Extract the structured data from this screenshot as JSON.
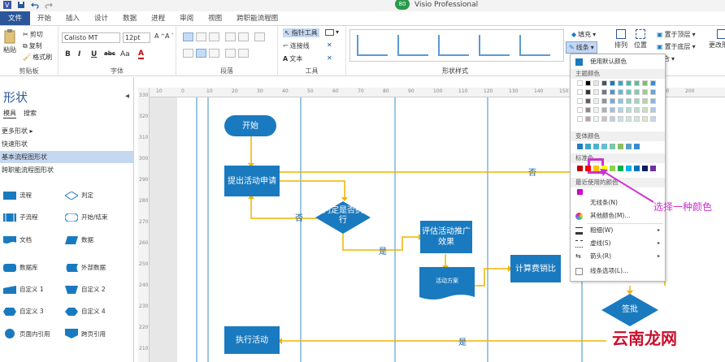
{
  "app": {
    "title": "Visio Professional",
    "badge": "80"
  },
  "tabs": [
    "文件",
    "开始",
    "插入",
    "设计",
    "数据",
    "进程",
    "审阅",
    "视图",
    "跨职能流程图"
  ],
  "ribbon": {
    "clipboard": {
      "label": "剪贴板",
      "paste": "粘贴",
      "cut": "剪切",
      "copy": "复制",
      "format_painter": "格式刷"
    },
    "font": {
      "label": "字体",
      "font_name": "Calisto MT",
      "font_size": "12pt",
      "bold": "B",
      "italic": "I",
      "underline": "U",
      "strike": "abc",
      "case": "Aa",
      "color": "A"
    },
    "paragraph": {
      "label": "段落"
    },
    "tools": {
      "label": "工具",
      "pointer": "指针工具",
      "connector": "连接线",
      "text": "文本"
    },
    "shape_styles": {
      "label": "形状样式"
    },
    "format": {
      "fill": "填充",
      "line": "线条",
      "arrange": "排列",
      "position": "位置",
      "bring_front": "置于顶层",
      "send_back": "置于底层",
      "group": "组合",
      "change_shape": "更改形状"
    }
  },
  "shapes_pane": {
    "title": "形状",
    "tabs": [
      "模具",
      "搜索"
    ],
    "stencils": [
      "更多形状",
      "快速形状",
      "基本流程图形状",
      "跨职能流程图形状"
    ],
    "selected_stencil": "基本流程图形状",
    "items": [
      {
        "label": "流程",
        "icon": "process-rect-icon"
      },
      {
        "label": "判定",
        "icon": "decision-diamond-icon"
      },
      {
        "label": "子流程",
        "icon": "subprocess-icon"
      },
      {
        "label": "开始/结束",
        "icon": "terminator-icon"
      },
      {
        "label": "文档",
        "icon": "document-icon"
      },
      {
        "label": "数据",
        "icon": "data-parallelogram-icon"
      },
      {
        "label": "数据库",
        "icon": "database-icon"
      },
      {
        "label": "外部数据",
        "icon": "external-data-icon"
      },
      {
        "label": "自定义 1",
        "icon": "custom1-icon"
      },
      {
        "label": "自定义 2",
        "icon": "custom2-icon"
      },
      {
        "label": "自定义 3",
        "icon": "custom3-icon"
      },
      {
        "label": "自定义 4",
        "icon": "custom4-icon"
      },
      {
        "label": "页面内引用",
        "icon": "on-page-ref-icon"
      },
      {
        "label": "跨页引用",
        "icon": "off-page-ref-icon"
      }
    ]
  },
  "ruler": {
    "h_ticks": [
      "10",
      "0",
      "10",
      "20",
      "30",
      "40",
      "50",
      "60",
      "70",
      "80",
      "90",
      "100",
      "110",
      "120",
      "130",
      "140",
      "150",
      "160",
      "170",
      "180",
      "190",
      "200"
    ],
    "v_ticks": [
      "330",
      "320",
      "310",
      "300",
      "290",
      "280",
      "270",
      "260",
      "250",
      "240",
      "230",
      "220",
      "210"
    ]
  },
  "diagram": {
    "start": "开始",
    "submit": "提出活动申请",
    "decision": "判定是否执行",
    "evaluate": "评估活动推广效果",
    "plan_doc": "活动方案",
    "calc": "计算费销比",
    "sign": "签批",
    "execute": "执行活动",
    "yes": "是",
    "no": "否"
  },
  "dropdown": {
    "use_default": "使用默认颜色",
    "theme_colors": "主题颜色",
    "variant_colors": "变体颜色",
    "standard_colors": "标准色",
    "recent_colors": "最近使用的颜色",
    "no_line": "无线条(N)",
    "more_colors": "其他颜色(M)...",
    "weight": "粗细(W)",
    "dashes": "虚线(S)",
    "arrows": "箭头(R)",
    "line_options": "线条选项(L)...",
    "standard_swatches": [
      "#c00000",
      "#ff0000",
      "#ffc000",
      "#ffff00",
      "#92d050",
      "#00b050",
      "#00b0f0",
      "#0070c0",
      "#002060",
      "#7030a0"
    ],
    "variant_swatches": [
      "#1f7fbf",
      "#39a7c7",
      "#4db3c9",
      "#66c0cf",
      "#7fc6ad",
      "#8fbf5e",
      "#5aa0c8",
      "#3b8bd1"
    ],
    "recent_swatches": [
      "#cc00cc"
    ]
  },
  "annotation": "选择一种颜色",
  "watermark": {
    "text": "云南龙网",
    "url": "www.xxxxx.com"
  },
  "colors": {
    "accent": "#2b579a",
    "shape_fill": "#1a7abf",
    "connector": "#f0b400",
    "highlight": "#cc33cc"
  }
}
